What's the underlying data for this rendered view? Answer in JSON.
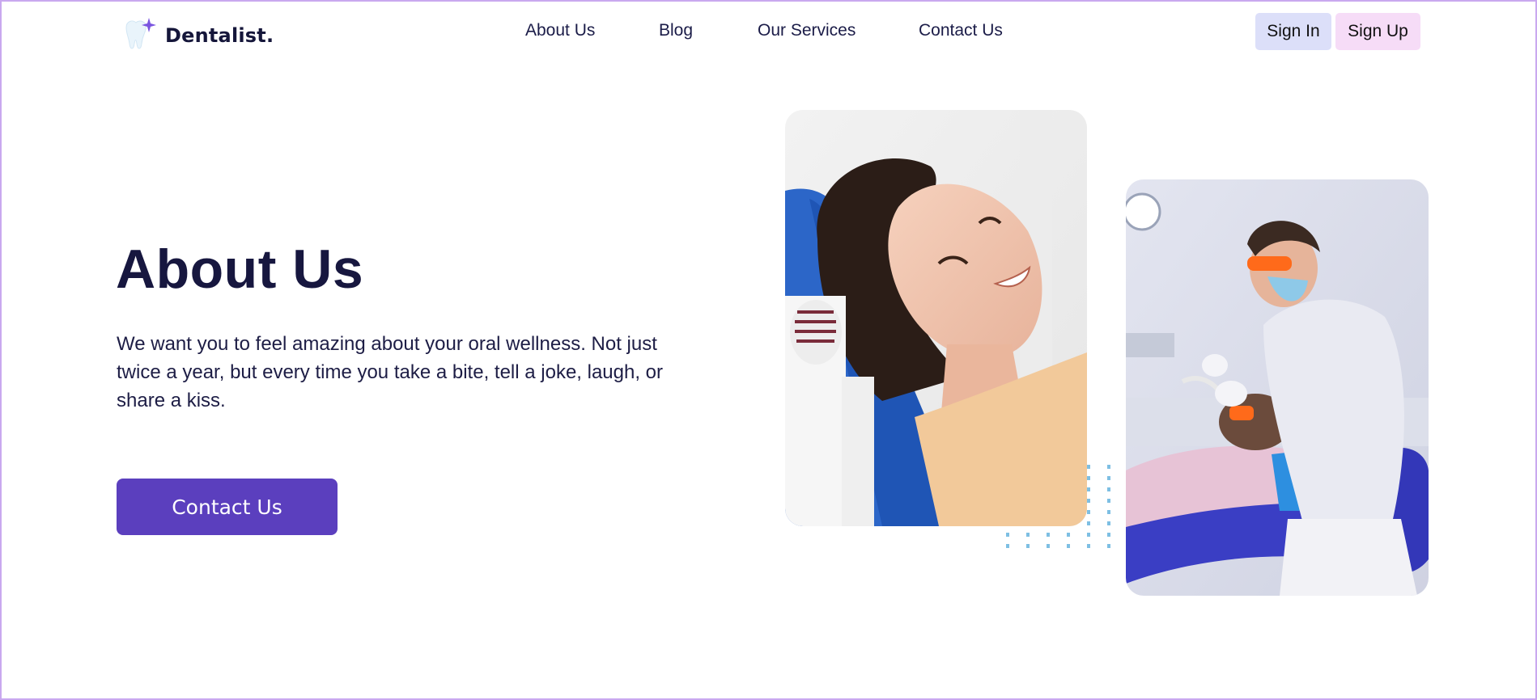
{
  "header": {
    "brand": "Dentalist.",
    "nav": [
      {
        "label": "About Us"
      },
      {
        "label": "Blog"
      },
      {
        "label": "Our Services"
      },
      {
        "label": "Contact Us"
      }
    ],
    "sign_in_label": "Sign In",
    "sign_up_label": "Sign Up"
  },
  "hero": {
    "title": "About Us",
    "description": "We want you to feel amazing about your oral wellness. Not just twice a year, but every time you take a bite, tell a joke, laugh, or share a kiss.",
    "cta_label": "Contact Us"
  },
  "images": {
    "patient_icon": "smiling-patient-photo",
    "dentist_icon": "dentist-treating-patient-photo"
  },
  "colors": {
    "primary": "#5b3fbe",
    "heading": "#17173f",
    "sign_in_bg": "#dcdff9",
    "sign_up_bg": "#f6dcf7",
    "dots": "#7ebfe3",
    "border": "#c9a8ef"
  }
}
